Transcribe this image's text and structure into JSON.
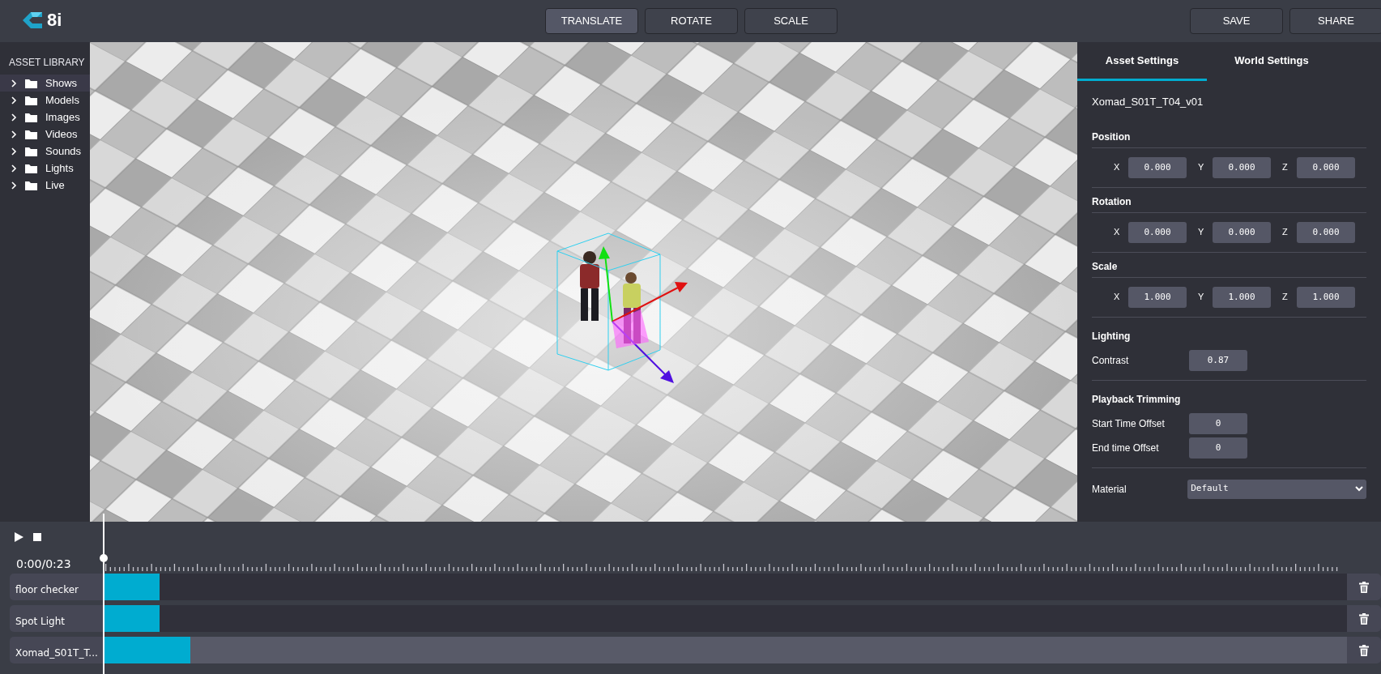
{
  "toolbar": {
    "logo": "8i",
    "tools": [
      {
        "label": "TRANSLATE",
        "selected": true
      },
      {
        "label": "ROTATE",
        "selected": false
      },
      {
        "label": "SCALE",
        "selected": false
      }
    ],
    "actions": [
      "SAVE",
      "SHARE"
    ]
  },
  "asset_library": {
    "title": "ASSET LIBRARY",
    "items": [
      {
        "label": "Shows",
        "selected": true
      },
      {
        "label": "Models",
        "selected": false
      },
      {
        "label": "Images",
        "selected": false
      },
      {
        "label": "Videos",
        "selected": false
      },
      {
        "label": "Sounds",
        "selected": false
      },
      {
        "label": "Lights",
        "selected": false
      },
      {
        "label": "Live",
        "selected": false
      }
    ]
  },
  "settings": {
    "tabs": [
      {
        "label": "Asset Settings",
        "selected": true
      },
      {
        "label": "World Settings",
        "selected": false
      }
    ],
    "asset_name": "Xomad_S01T_T04_v01",
    "sections": [
      {
        "kind": "xyz",
        "title": "Position",
        "fields": [
          {
            "axis": "X",
            "value": "0.000"
          },
          {
            "axis": "Y",
            "value": "0.000"
          },
          {
            "axis": "Z",
            "value": "0.000"
          }
        ]
      },
      {
        "kind": "xyz",
        "title": "Rotation",
        "fields": [
          {
            "axis": "X",
            "value": "0.000"
          },
          {
            "axis": "Y",
            "value": "0.000"
          },
          {
            "axis": "Z",
            "value": "0.000"
          }
        ]
      },
      {
        "kind": "xyz",
        "title": "Scale",
        "fields": [
          {
            "axis": "X",
            "value": "1.000"
          },
          {
            "axis": "Y",
            "value": "1.000"
          },
          {
            "axis": "Z",
            "value": "1.000"
          }
        ]
      },
      {
        "kind": "rows",
        "title": "Lighting",
        "rows": [
          {
            "label": "Contrast",
            "value": "0.87"
          }
        ]
      },
      {
        "kind": "rows",
        "title": "Playback Trimming",
        "rows": [
          {
            "label": "Start Time Offset",
            "value": "0"
          },
          {
            "label": "End time Offset",
            "value": "0"
          }
        ]
      },
      {
        "kind": "select",
        "label": "Material",
        "value": "Default"
      }
    ]
  },
  "timeline": {
    "time": "0:00/0:23",
    "tracks": [
      {
        "label": "floor checker",
        "selected": false,
        "level": 0.045
      },
      {
        "label": "Spot Light",
        "selected": false,
        "level": 0.045
      },
      {
        "label": "Xomad_S01T_T...",
        "selected": true,
        "level": 0.07
      }
    ]
  }
}
